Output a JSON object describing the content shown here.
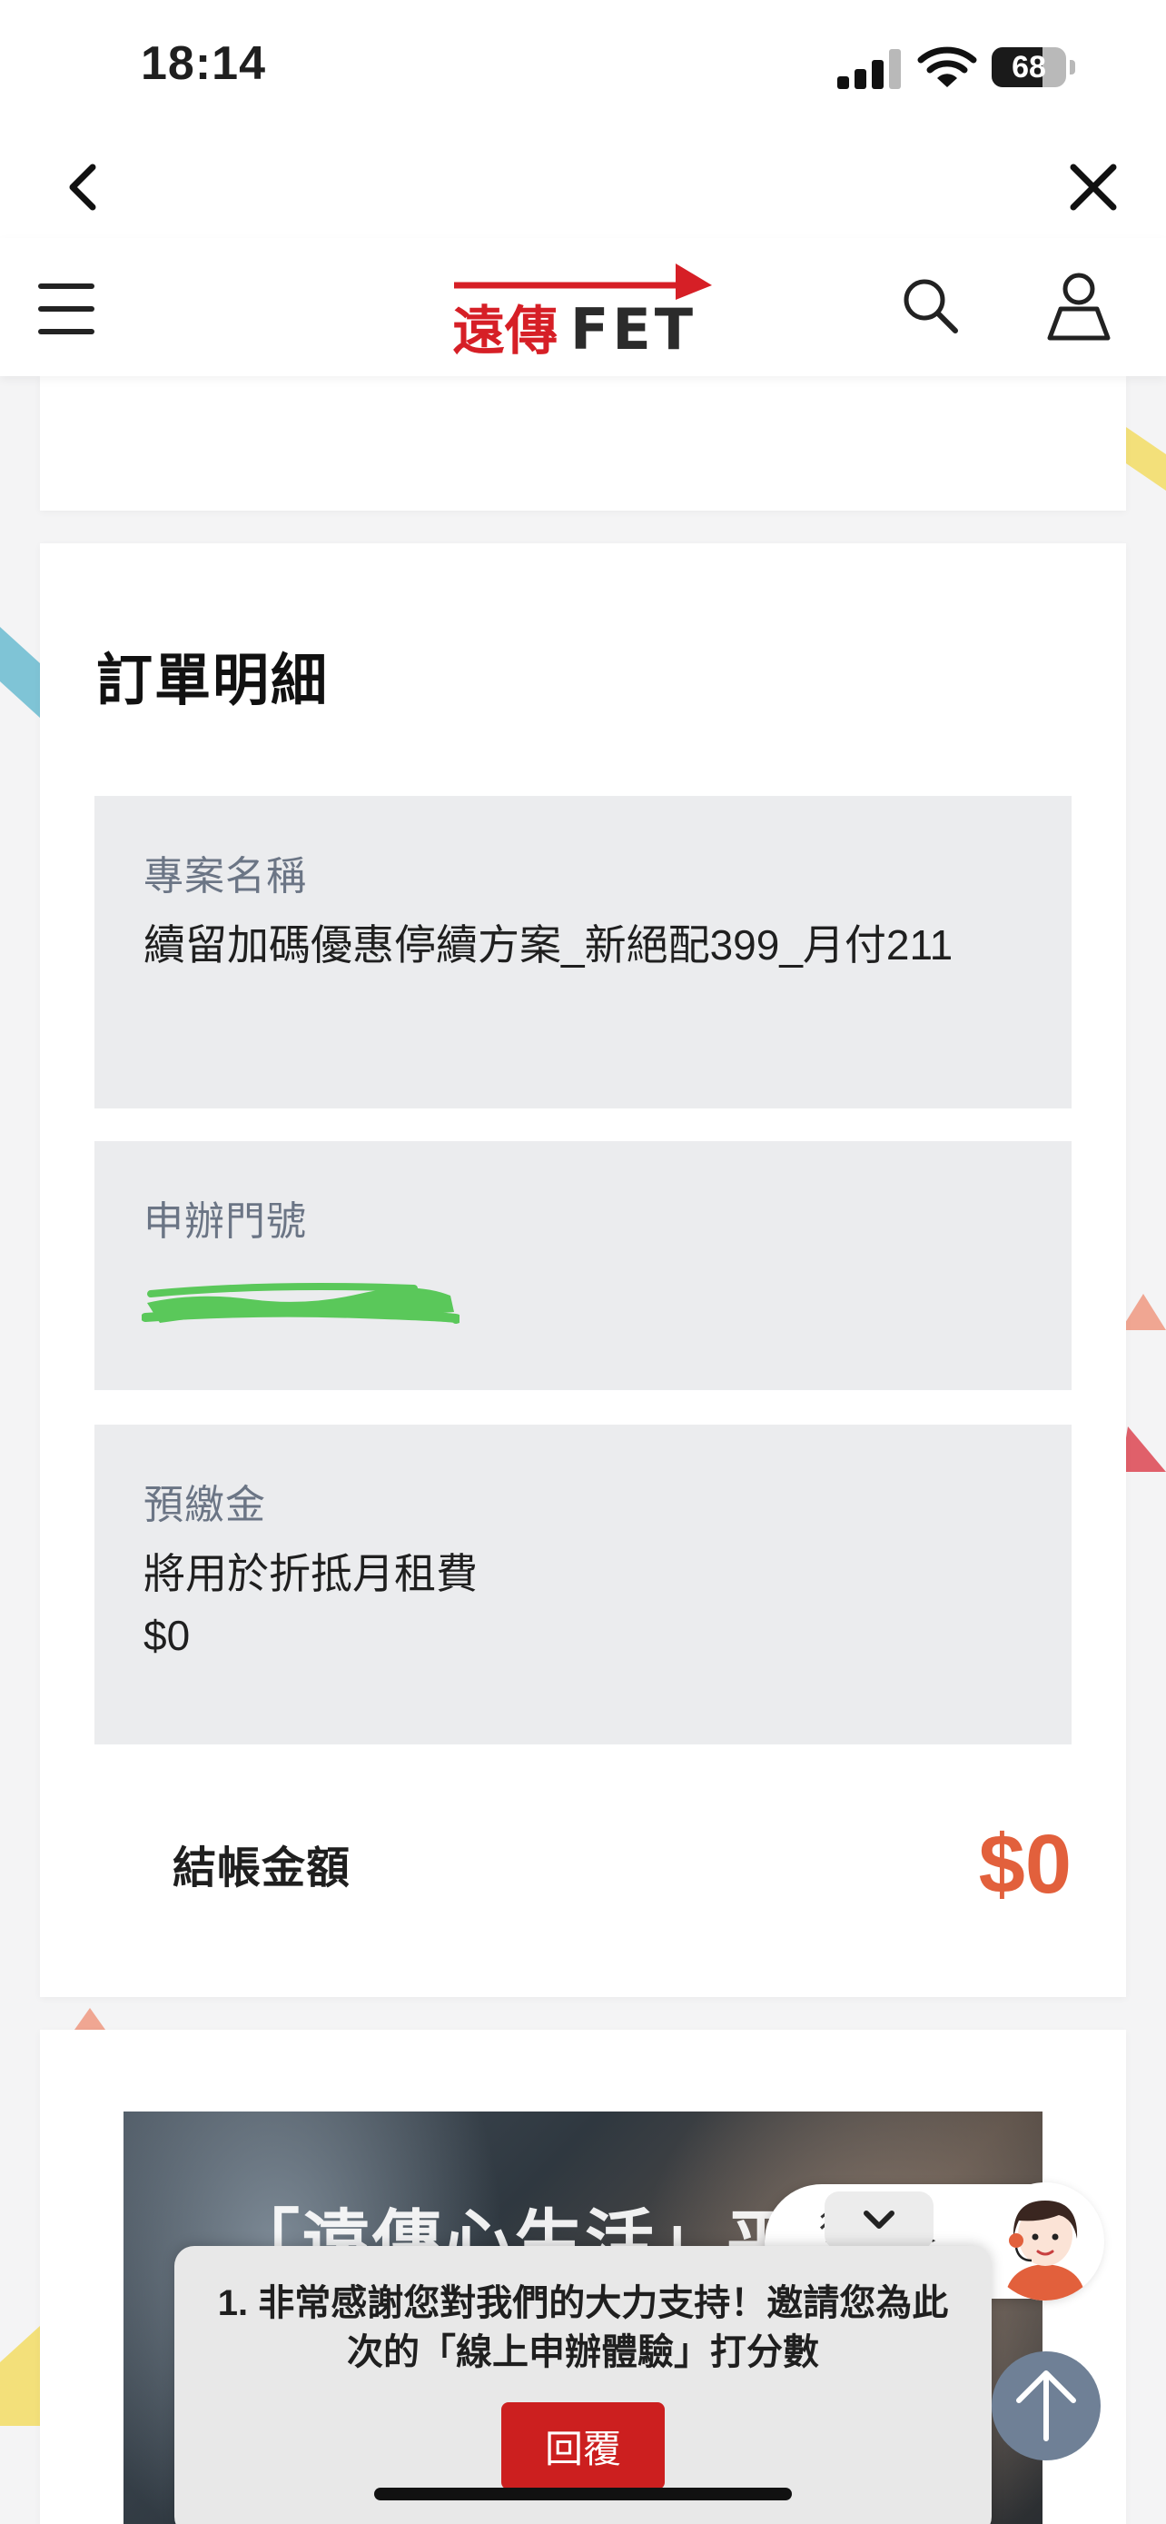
{
  "status_bar": {
    "time": "18:14",
    "battery_percent": "68",
    "battery_level": 0.68
  },
  "browser_bar": {
    "back_icon": "chevron-left-icon",
    "close_icon": "close-icon"
  },
  "site_header": {
    "logo_text_cjk": "遠傳",
    "logo_text_latin": "FET",
    "menu_icon": "hamburger-icon",
    "search_icon": "search-icon",
    "account_icon": "user-icon"
  },
  "order": {
    "title": "訂單明細",
    "project_label": "專案名稱",
    "project_value": "續留加碼優惠停續方案_新絕配399_月付211",
    "number_label": "申辦門號",
    "prepay_label": "預繳金",
    "prepay_desc": "將用於折抵月租費",
    "prepay_amount": "$0",
    "total_label": "結帳金額",
    "total_amount": "$0"
  },
  "promo": {
    "title": "「遠傳心生活」平台"
  },
  "survey": {
    "question": "1. 非常感謝您對我們的大力支持！邀請您為此次的「線上申辦體驗」打分數",
    "reply_label": "回覆"
  },
  "chat": {
    "partial_text": "行買"
  },
  "colors": {
    "accent": "#e2603c",
    "brand_red": "#cc1f1f",
    "block_bg": "#ebecee",
    "label_gray": "#6b7585",
    "scroll_top_bg": "#6f8096"
  }
}
